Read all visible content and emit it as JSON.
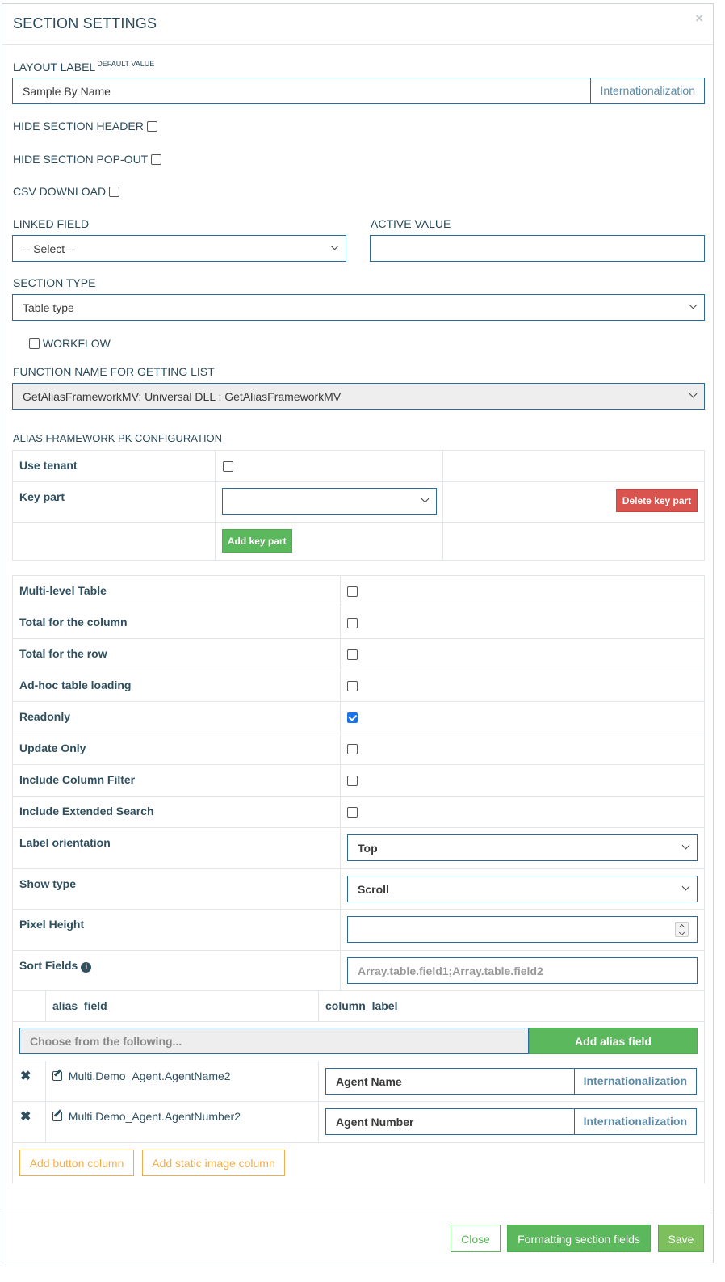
{
  "header": {
    "title": "SECTION SETTINGS",
    "close": "×"
  },
  "layout_label": {
    "label": "LAYOUT LABEL",
    "sup": "DEFAULT VALUE",
    "value": "Sample By Name",
    "addon": "Internationalization"
  },
  "hide_section_header": "HIDE SECTION HEADER",
  "hide_section_popout": "HIDE SECTION POP-OUT",
  "csv_download": "CSV DOWNLOAD",
  "linked_field": {
    "label": "LINKED FIELD",
    "value": "-- Select --"
  },
  "active_value": {
    "label": "ACTIVE VALUE",
    "value": ""
  },
  "section_type": {
    "label": "SECTION TYPE",
    "value": "Table type"
  },
  "workflow": "WORKFLOW",
  "function_name": {
    "label": "FUNCTION NAME FOR GETTING LIST",
    "value": "GetAliasFrameworkMV: Universal DLL : GetAliasFrameworkMV"
  },
  "pk_config": {
    "title": "ALIAS FRAMEWORK PK CONFIGURATION",
    "use_tenant": "Use tenant",
    "key_part": "Key part",
    "delete_key_part": "Delete key part",
    "add_key_part": "Add key part"
  },
  "options": {
    "multi_level": "Multi-level Table",
    "total_column": "Total for the column",
    "total_row": "Total for the row",
    "adhoc": "Ad-hoc table loading",
    "readonly": "Readonly",
    "update_only": "Update Only",
    "column_filter": "Include Column Filter",
    "extended_search": "Include Extended Search",
    "label_orientation": "Label orientation",
    "label_orientation_value": "Top",
    "show_type": "Show type",
    "show_type_value": "Scroll",
    "pixel_height": "Pixel Height",
    "sort_fields": "Sort Fields",
    "sort_fields_placeholder": "Array.table.field1;Array.table.field2"
  },
  "alias_table": {
    "col_alias": "alias_field",
    "col_label": "column_label",
    "choose_placeholder": "Choose from the following...",
    "add_alias": "Add alias field",
    "rows": [
      {
        "field": "Multi.Demo_Agent.AgentName2",
        "label": "Agent Name",
        "addon": "Internationalization"
      },
      {
        "field": "Multi.Demo_Agent.AgentNumber2",
        "label": "Agent Number",
        "addon": "Internationalization"
      }
    ],
    "add_button_column": "Add button column",
    "add_static_image_column": "Add static image column"
  },
  "footer": {
    "close": "Close",
    "formatting": "Formatting section fields",
    "save": "Save"
  }
}
